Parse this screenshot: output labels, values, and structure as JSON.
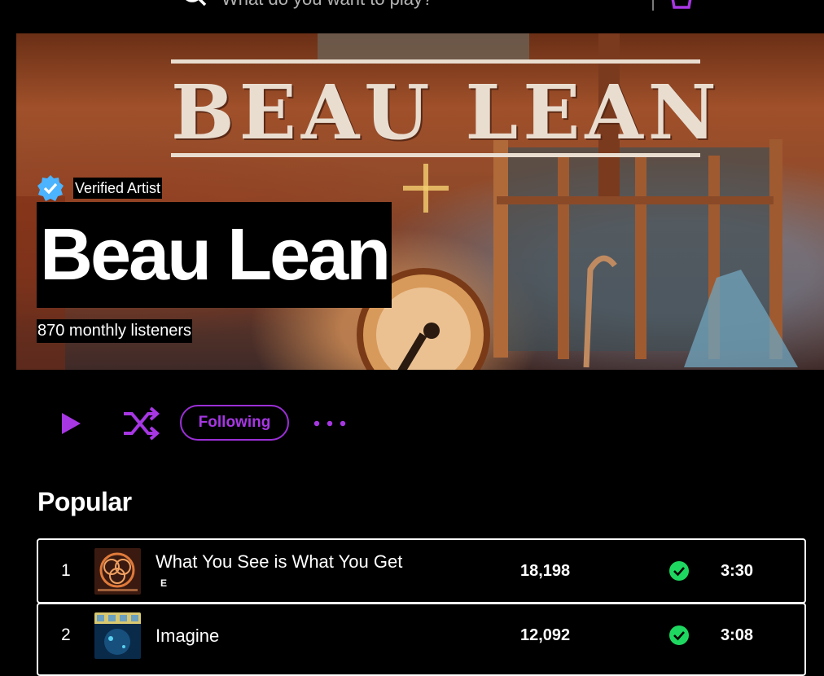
{
  "topbar": {
    "search_placeholder": "What do you want to play?",
    "icons": [
      "home-icon",
      "search-icon",
      "basket-icon"
    ]
  },
  "artist": {
    "banner_logo_text": "BEAU LEAN",
    "verified_label": "Verified Artist",
    "name": "Beau Lean",
    "monthly_listeners": "870 monthly listeners"
  },
  "actions": {
    "follow_label": "Following",
    "icons": [
      "play-icon",
      "shuffle-icon",
      "more-icon"
    ]
  },
  "popular": {
    "title": "Popular",
    "tracks": [
      {
        "num": "1",
        "title": "What You See is What You Get",
        "explicit": "E",
        "plays": "18,198",
        "duration": "3:30"
      },
      {
        "num": "2",
        "title": "Imagine",
        "plays": "12,092",
        "duration": "3:08"
      }
    ]
  },
  "colors": {
    "accent": "#a737e3",
    "saved_check": "#1ed760",
    "background": "#000000"
  }
}
